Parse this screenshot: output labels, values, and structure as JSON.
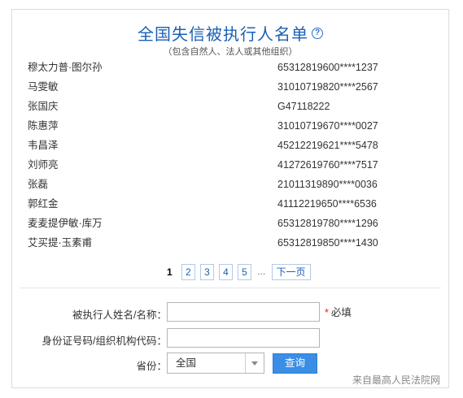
{
  "header": {
    "title": "全国失信被执行人名单",
    "help_icon": "question-circle-icon",
    "subtitle": "（包含自然人、法人或其他组织）"
  },
  "list": [
    {
      "name": "穆太力普·图尔孙",
      "id": "65312819600****1237"
    },
    {
      "name": "马雯敏",
      "id": "31010719820****2567"
    },
    {
      "name": "张国庆",
      "id": "G47118222"
    },
    {
      "name": "陈惠萍",
      "id": "31010719670****0027"
    },
    {
      "name": "韦昌泽",
      "id": "45212219621****5478"
    },
    {
      "name": "刘师亮",
      "id": "41272619760****7517"
    },
    {
      "name": "张磊",
      "id": "21011319890****0036"
    },
    {
      "name": "郭红金",
      "id": "41112219650****6536"
    },
    {
      "name": "麦麦提伊敏·库万",
      "id": "65312819780****1296"
    },
    {
      "name": "艾买提·玉素甫",
      "id": "65312819850****1430"
    }
  ],
  "pagination": {
    "current": "1",
    "pages": [
      "2",
      "3",
      "4",
      "5"
    ],
    "ellipsis": "...",
    "next_label": "下一页"
  },
  "form": {
    "name_label": "被执行人姓名/名称：",
    "name_value": "",
    "required_mark": "*",
    "required_text": "必填",
    "id_label": "身份证号码/组织机构代码：",
    "id_value": "",
    "province_label": "省份：",
    "province_value": "全国",
    "submit_label": "查询"
  },
  "footer": {
    "source_text": "来自最高人民法院网"
  },
  "colors": {
    "title": "#1a5fb4",
    "button": "#3a8ee6",
    "required": "#dd2222",
    "link": "#1a5fb4"
  }
}
